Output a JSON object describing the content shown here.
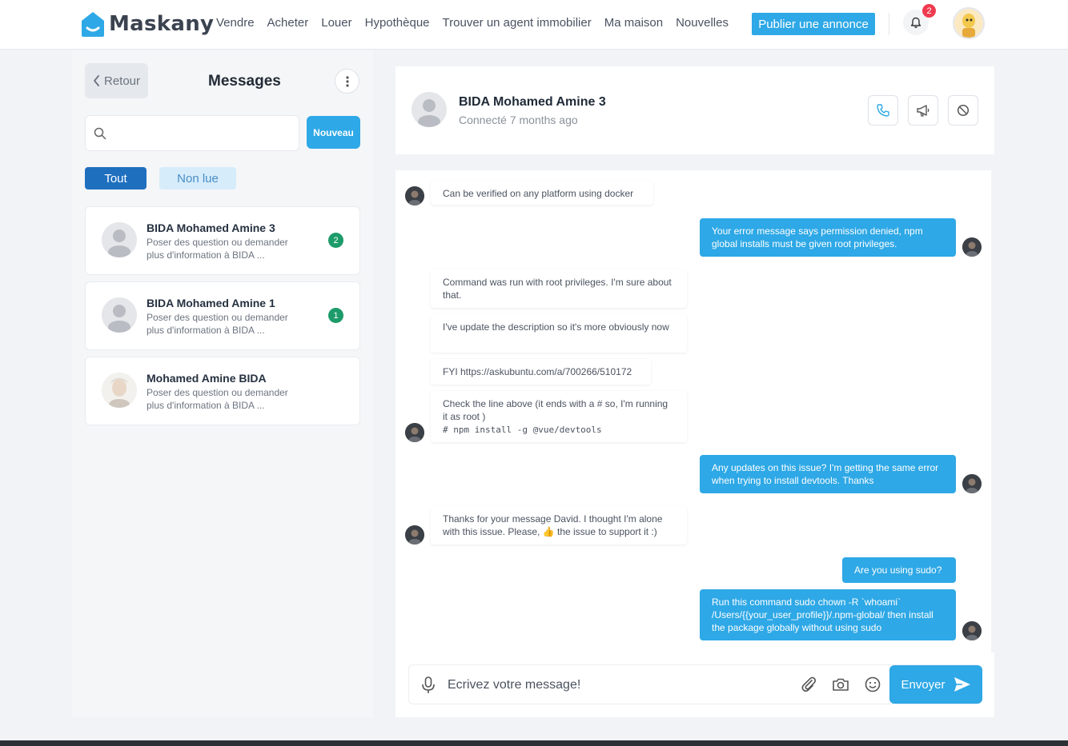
{
  "brand": {
    "name": "Maskany",
    "accent": "#2ea8e6"
  },
  "nav": {
    "items": [
      "Vendre",
      "Acheter",
      "Louer",
      "Hypothèque",
      "Trouver un agent immobilier",
      "Ma maison",
      "Nouvelles"
    ],
    "publish_label": "Publier une annonce",
    "notification_count": "2",
    "icons": {
      "notifications": "bell-icon",
      "profile": "avatar"
    }
  },
  "sidebar": {
    "back_label": "Retour",
    "title": "Messages",
    "search": {
      "placeholder": "",
      "value": ""
    },
    "new_label": "Nouveau",
    "filters": {
      "all": "Tout",
      "unread": "Non lue"
    },
    "conversations": [
      {
        "name": "BIDA Mohamed Amine 3",
        "preview": "Poser des question ou demander plus d'information à BIDA ...",
        "unread": "2"
      },
      {
        "name": "BIDA Mohamed Amine 1",
        "preview": "Poser des question ou demander plus d'information à BIDA ...",
        "unread": "1"
      },
      {
        "name": "Mohamed Amine BIDA",
        "preview": "Poser des question ou demander plus d'information à BIDA ...",
        "unread": ""
      }
    ]
  },
  "chat": {
    "contact_name": "BIDA Mohamed Amine 3",
    "status": "Connecté 7 months ago",
    "actions": [
      "phone-icon",
      "megaphone-icon",
      "block-icon"
    ],
    "messages": [
      {
        "dir": "in",
        "text": "Can be verified on any platform using docker"
      },
      {
        "dir": "out",
        "text": "Your error message says permission denied, npm global installs must be given root privileges."
      },
      {
        "dir": "in",
        "text": "Command was run with root privileges. I'm sure about that."
      },
      {
        "dir": "in",
        "text": "I've update the description so it's more obviously now"
      },
      {
        "dir": "in",
        "text": "FYI https://askubuntu.com/a/700266/510172"
      },
      {
        "dir": "in",
        "text": "Check the line above (it ends with a # so, I'm running it as root )",
        "code": "# npm install -g @vue/devtools"
      },
      {
        "dir": "out",
        "text": "Any updates on this issue? I'm getting the same error when trying to install devtools. Thanks"
      },
      {
        "dir": "in",
        "text": "Thanks for your message David. I thought I'm alone with this issue. Please, 👍 the issue to support it :)"
      },
      {
        "dir": "out",
        "text": "Are you using sudo?"
      },
      {
        "dir": "out",
        "text": "Run this command sudo chown -R `whoami` /Users/{{your_user_profile}}/.npm-global/ then install the package globally without using sudo"
      }
    ]
  },
  "composer": {
    "placeholder": "Ecrivez votre message!",
    "value": "",
    "send_label": "Envoyer",
    "icons": [
      "microphone-icon",
      "paperclip-icon",
      "camera-icon",
      "emoji-icon",
      "send-icon"
    ]
  }
}
